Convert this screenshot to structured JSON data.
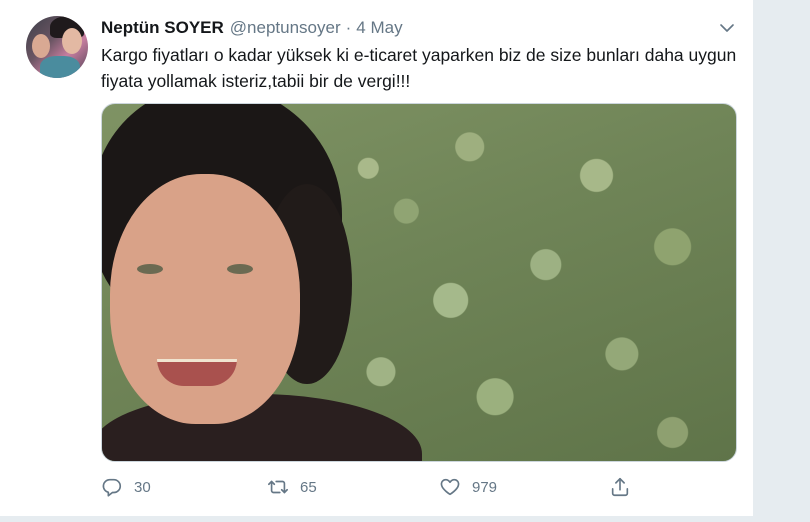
{
  "tweet": {
    "author_name": "Neptün SOYER",
    "handle": "@neptunsoyer",
    "separator": "·",
    "date": "4 May",
    "text": "Kargo fiyatları o kadar yüksek ki e-ticaret yaparken biz de size bunları daha uygun fiyata yollamak isteriz,tabii bir de vergi!!!",
    "counts": {
      "replies": "30",
      "retweets": "65",
      "likes": "979"
    }
  },
  "icons": {
    "more": "chevron-down-icon",
    "reply": "reply-icon",
    "retweet": "retweet-icon",
    "like": "heart-icon",
    "share": "share-icon"
  },
  "colors": {
    "muted": "#657786",
    "text": "#14171a",
    "border": "#e6ecf0"
  }
}
